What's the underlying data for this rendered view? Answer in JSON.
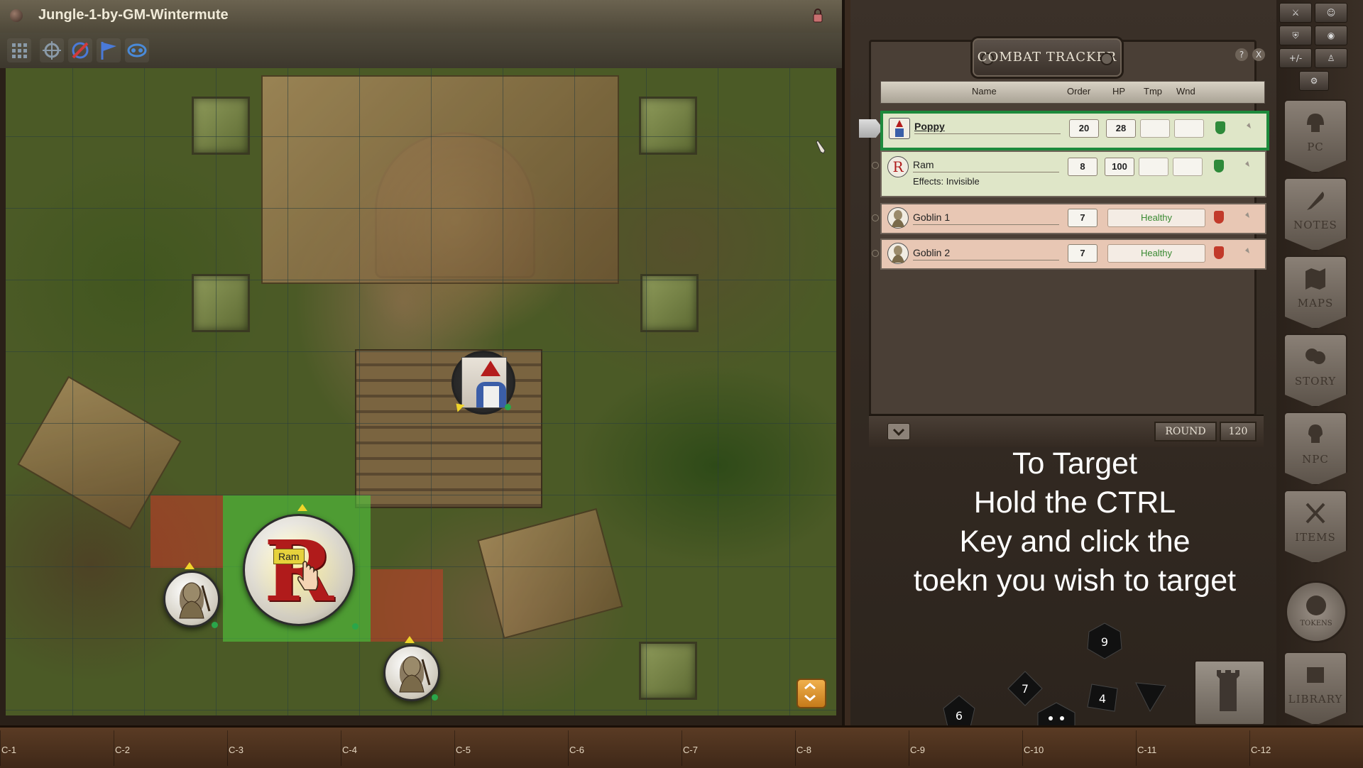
{
  "map": {
    "title": "Jungle-1-by-GM-Wintermute",
    "tokens": {
      "ram_name": "Ram",
      "ram_letter": "R"
    }
  },
  "combat_tracker": {
    "title": "COMBAT TRACKER",
    "help_label": "?",
    "close_label": "X",
    "columns": [
      "Name",
      "Order",
      "HP",
      "Tmp",
      "Wnd"
    ],
    "rows": [
      {
        "name": "Poppy",
        "order": "20",
        "hp": "28",
        "tmp": "",
        "wnd": "",
        "faction": "friend",
        "active": true
      },
      {
        "name": "Ram",
        "order": "8",
        "hp": "100",
        "tmp": "",
        "wnd": "",
        "faction": "friend",
        "effects": "Effects: Invisible"
      },
      {
        "name": "Goblin 1",
        "order": "7",
        "status": "Healthy",
        "faction": "foe"
      },
      {
        "name": "Goblin 2",
        "order": "7",
        "status": "Healthy",
        "faction": "foe"
      }
    ],
    "round_label": "ROUND",
    "round_value": "120",
    "ram_portrait_letter": "R"
  },
  "instructions": {
    "lines": [
      "To Target",
      "Hold the CTRL",
      "Key and click the",
      "toekn you wish to target"
    ]
  },
  "dice": [
    "6",
    "7",
    "9",
    "4"
  ],
  "sidebar": {
    "small_buttons": [
      "+/-"
    ],
    "buttons": [
      "PC",
      "NOTES",
      "MAPS",
      "STORY",
      "NPC",
      "ITEMS",
      "TOKENS",
      "LIBRARY"
    ]
  },
  "hotkeys": [
    "C-1",
    "C-2",
    "C-3",
    "C-4",
    "C-5",
    "C-6",
    "C-7",
    "C-8",
    "C-9",
    "C-10",
    "C-11",
    "C-12"
  ],
  "colors": {
    "friend_row": "#dfe6c8",
    "foe_row": "#e8c7b4",
    "active_border": "#1d8a3c",
    "healthy_text": "#3a8a32",
    "ram_letter": "#b01b1b"
  }
}
